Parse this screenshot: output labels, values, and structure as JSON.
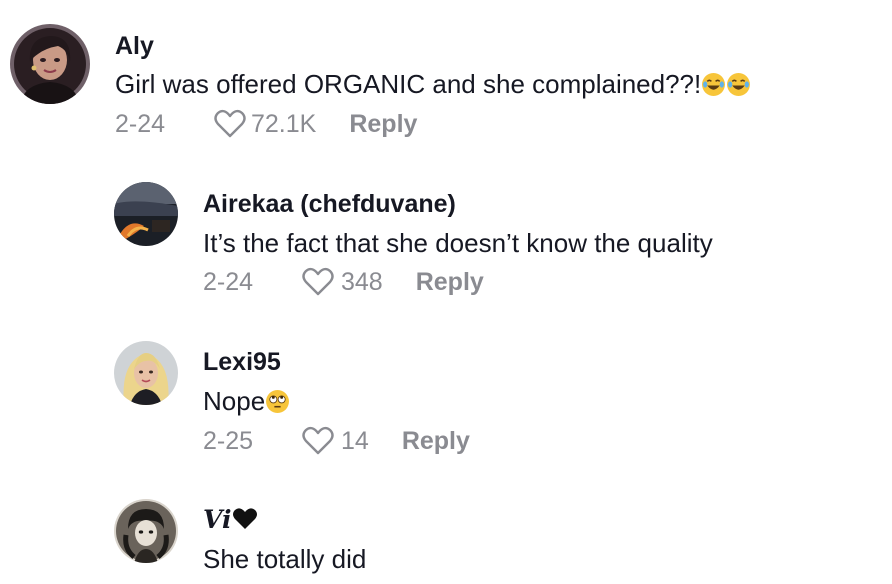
{
  "comments": [
    {
      "username": "Aly",
      "text": "Girl was offered ORGANIC and she complained??!",
      "emoji": "face-with-tears-of-joy x2",
      "date": "2-24",
      "likes": "72.1K",
      "reply_label": "Reply"
    },
    {
      "username": "Airekaa (chefduvane)",
      "text": "It’s the fact that she doesn’t know the quality",
      "date": "2-24",
      "likes": "348",
      "reply_label": "Reply"
    },
    {
      "username": "Lexi95",
      "text": "Nope",
      "emoji": "face-with-rolling-eyes",
      "date": "2-25",
      "likes": "14",
      "reply_label": "Reply"
    },
    {
      "username": "Vi",
      "username_emoji": "black-heart",
      "text": "She totally did"
    }
  ],
  "colors": {
    "text_primary": "#161823",
    "text_secondary": "#8a8b91",
    "background": "#ffffff"
  },
  "icons": {
    "like": "heart-outline-icon",
    "heart": "black-heart-icon"
  }
}
